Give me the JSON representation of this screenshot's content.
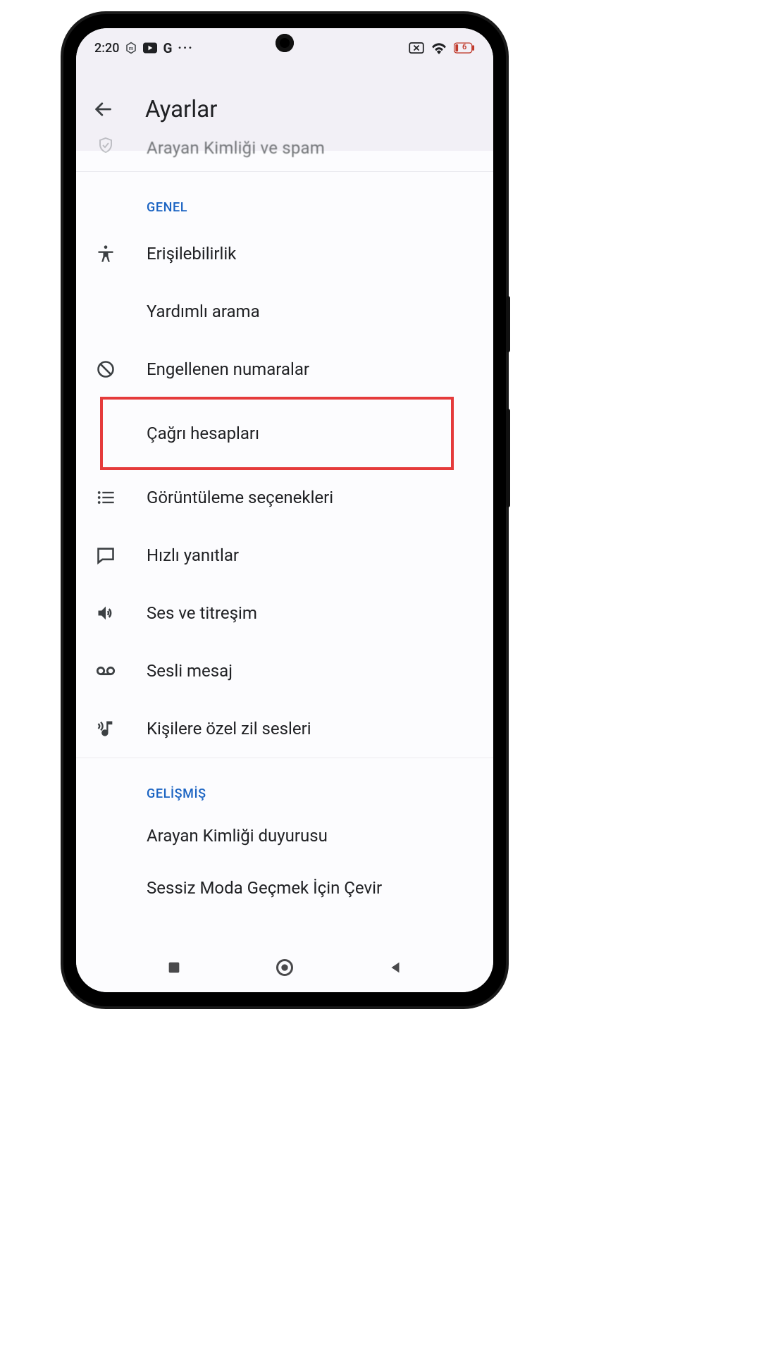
{
  "status_bar": {
    "time": "2:20",
    "mi_icon": "mi-badge-icon",
    "youtube_icon": "youtube-icon",
    "g_label": "G",
    "dots": "···",
    "close_card_icon": "x-card-icon",
    "wifi_icon": "wifi-icon",
    "battery_icon": "battery-low-icon",
    "battery_text": "6"
  },
  "app_bar": {
    "back_icon": "arrow-back-icon",
    "title": "Ayarlar"
  },
  "cutoff": {
    "text": "Arayan Kimliği ve spam"
  },
  "sections": {
    "general": {
      "header": "GENEL",
      "items": [
        {
          "icon": "accessibility-icon",
          "label": "Erişilebilirlik"
        },
        {
          "icon": "",
          "label": "Yardımlı arama"
        },
        {
          "icon": "block-icon",
          "label": "Engellenen numaralar"
        },
        {
          "icon": "",
          "label": "Çağrı hesapları",
          "highlight": true
        },
        {
          "icon": "list-icon",
          "label": "Görüntüleme seçenekleri"
        },
        {
          "icon": "chat-icon",
          "label": "Hızlı yanıtlar"
        },
        {
          "icon": "volume-icon",
          "label": "Ses ve titreşim"
        },
        {
          "icon": "voicemail-icon",
          "label": "Sesli mesaj"
        },
        {
          "icon": "ringtone-icon",
          "label": "Kişilere özel zil sesleri"
        }
      ]
    },
    "advanced": {
      "header": "GELİŞMİŞ",
      "items": [
        {
          "icon": "",
          "label": "Arayan Kimliği duyurusu"
        },
        {
          "icon": "",
          "label": "Sessiz Moda Geçmek İçin Çevir"
        }
      ]
    }
  },
  "nav": {
    "recents_icon": "square-icon",
    "home_icon": "circle-icon",
    "back_icon": "triangle-back-icon"
  },
  "highlight_color": "#e53b3b",
  "accent_color": "#1a63c2"
}
